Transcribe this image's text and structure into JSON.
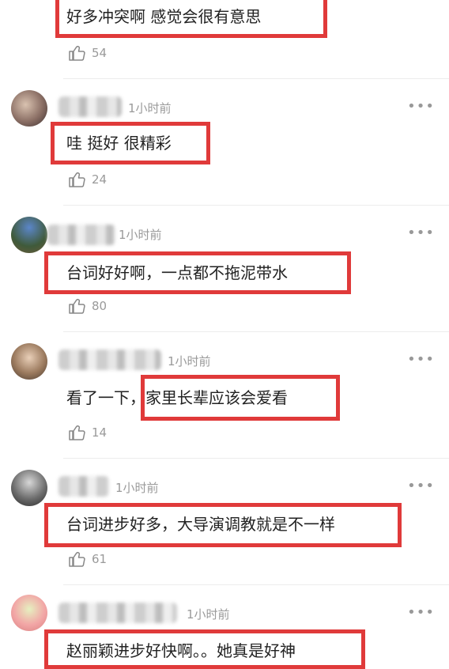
{
  "comments": [
    {
      "text": "好多冲突啊 感觉会很有意思",
      "likes": "54"
    },
    {
      "time": "1小时前",
      "text": "哇 挺好 很精彩",
      "likes": "24"
    },
    {
      "time": "1小时前",
      "text": "台词好好啊，一点都不拖泥带水",
      "likes": "80"
    },
    {
      "time": "1小时前",
      "text": "看了一下，家里长辈应该会爱看",
      "likes": "14"
    },
    {
      "time": "1小时前",
      "text": "台词进步好多，大导演调教就是不一样",
      "likes": "61"
    },
    {
      "time": "1小时前",
      "text": "赵丽颖进步好快啊。。她真是好神"
    }
  ],
  "icons": {
    "like": "thumbs-up-icon",
    "more": "more-dots-icon"
  },
  "colors": {
    "highlight": "#e03a3a",
    "muted": "#9a9a9a"
  }
}
